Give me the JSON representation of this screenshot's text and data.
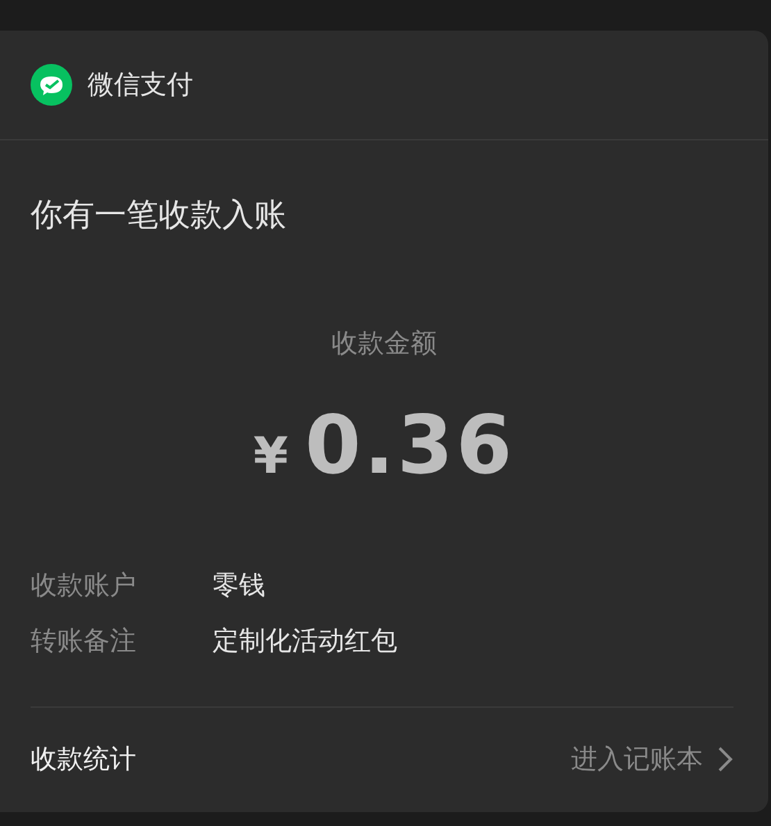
{
  "header": {
    "app_name": "微信支付"
  },
  "title": "你有一笔收款入账",
  "amount": {
    "label": "收款金额",
    "currency": "¥",
    "value": "0.36"
  },
  "details": [
    {
      "label": "收款账户",
      "value": "零钱"
    },
    {
      "label": "转账备注",
      "value": "定制化活动红包"
    }
  ],
  "footer": {
    "label": "收款统计",
    "link": "进入记账本"
  }
}
